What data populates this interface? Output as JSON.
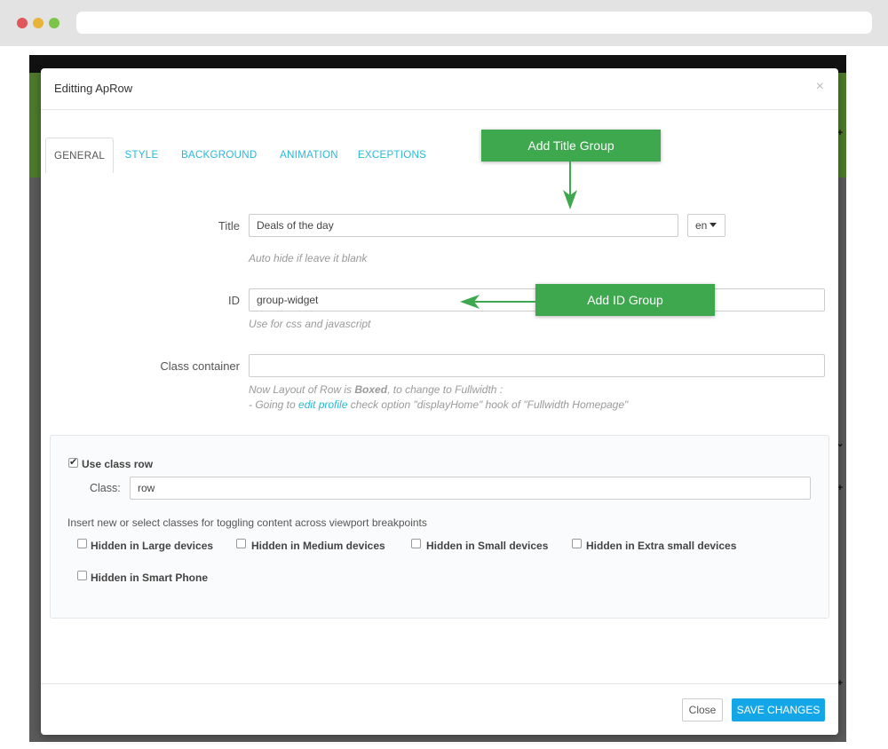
{
  "colors": {
    "accent": "#25b9d7",
    "primary_button": "#14a7e8",
    "callout": "#3ea84f"
  },
  "modal": {
    "title": "Editting ApRow",
    "close_icon": "×"
  },
  "tabs": [
    {
      "label": "GENERAL",
      "active": true
    },
    {
      "label": "STYLE",
      "active": false
    },
    {
      "label": "BACKGROUND",
      "active": false
    },
    {
      "label": "ANIMATION",
      "active": false
    },
    {
      "label": "EXCEPTIONS",
      "active": false
    }
  ],
  "form": {
    "title_label": "Title",
    "title_value": "Deals of the day",
    "language": "en",
    "title_help": "Auto hide if leave it blank",
    "id_label": "ID",
    "id_value": "group-widget",
    "id_help": "Use for css and javascript",
    "class_container_label": "Class container",
    "class_container_value": "",
    "layout_note_prefix": "Now Layout of Row is ",
    "layout_note_bold": "Boxed",
    "layout_note_suffix": ", to change to Fullwidth :",
    "going_prefix": "- Going to ",
    "going_link": "edit profile",
    "going_suffix": " check option \"displayHome\" hook of \"Fullwidth Homepage\""
  },
  "row_options": {
    "use_class_row_label": "Use class row",
    "use_class_row_checked": true,
    "class_label": "Class:",
    "class_value": "row",
    "insert_note": "Insert new or select classes for toggling content across viewport breakpoints",
    "hidden_options": [
      {
        "label": "Hidden in Large devices",
        "checked": false
      },
      {
        "label": "Hidden in Medium devices",
        "checked": false
      },
      {
        "label": "Hidden in Small devices",
        "checked": false
      },
      {
        "label": "Hidden in Extra small devices",
        "checked": false
      },
      {
        "label": "Hidden in Smart Phone",
        "checked": false
      }
    ]
  },
  "footer": {
    "close_label": "Close",
    "save_label": "SAVE CHANGES"
  },
  "annotations": {
    "title_group": "Add Title Group",
    "id_group": "Add ID Group"
  }
}
